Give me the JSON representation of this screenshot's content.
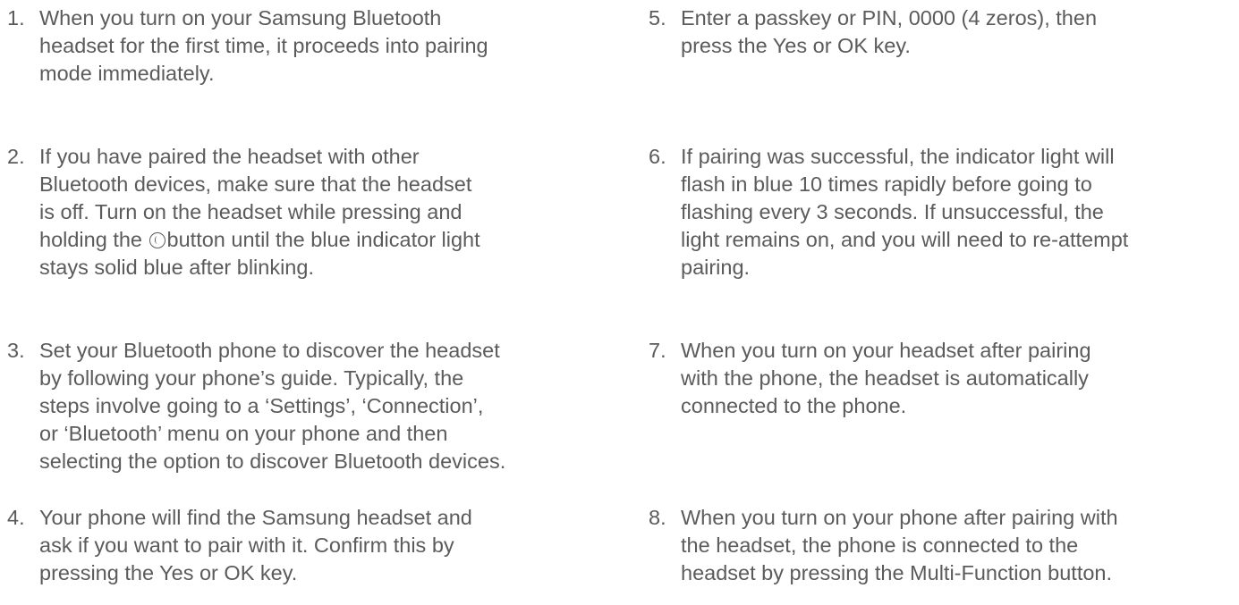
{
  "steps": [
    {
      "number": "1.",
      "lines": [
        "When you turn on your Samsung Bluetooth",
        "headset for the first time, it proceeds into pairing",
        "mode immediately."
      ]
    },
    {
      "number": "2.",
      "lines": [
        "If you have paired the headset with other",
        "Bluetooth devices, make sure that the headset",
        "is off. Turn on the headset while pressing and",
        "holding the",
        "button until the blue indicator light",
        "stays solid blue after blinking."
      ],
      "icon": "call-button-icon"
    },
    {
      "number": "3.",
      "lines": [
        "Set your Bluetooth phone to discover the headset",
        "by following your phone’s guide. Typically, the",
        "steps involve going to a ‘Settings’, ‘Connection’,",
        "or ‘Bluetooth’ menu on your phone and then",
        "selecting the option to discover Bluetooth devices."
      ]
    },
    {
      "number": "4.",
      "lines": [
        "Your phone will find the Samsung headset and",
        "ask if you want to pair with it. Confirm this by",
        "pressing the Yes or OK key."
      ]
    },
    {
      "number": "5.",
      "lines": [
        "Enter a passkey or PIN, 0000 (4 zeros), then",
        "press the Yes or OK key."
      ]
    },
    {
      "number": "6.",
      "lines": [
        "If pairing was successful, the indicator light will",
        "flash in blue 10 times rapidly before going to",
        "flashing every 3 seconds. If unsuccessful, the",
        "light remains on, and you will need to re-attempt",
        "pairing."
      ]
    },
    {
      "number": "7.",
      "lines": [
        "When you turn on your headset after pairing",
        "with the phone, the headset is automatically",
        "connected to the phone."
      ]
    },
    {
      "number": "8.",
      "lines": [
        "When you turn on your phone after pairing with",
        "the headset, the phone is connected to the",
        "headset by pressing the Multi-Function button."
      ]
    }
  ]
}
